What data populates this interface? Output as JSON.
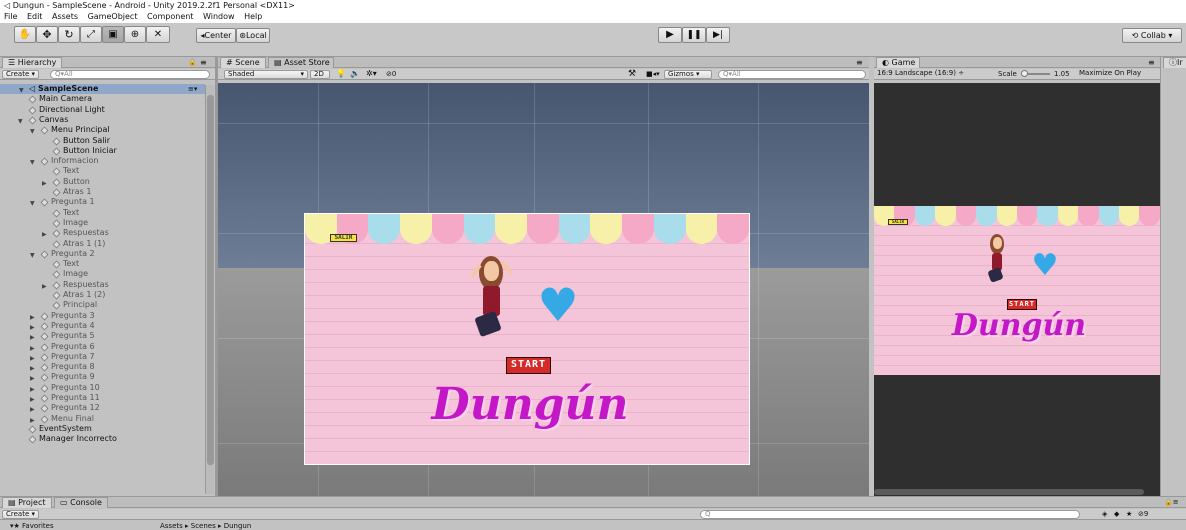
{
  "title": "Dungun - SampleScene - Android - Unity 2019.2.2f1 Personal <DX11>",
  "menu": [
    "File",
    "Edit",
    "Assets",
    "GameObject",
    "Component",
    "Window",
    "Help"
  ],
  "toolbar": {
    "tools": [
      "hand-tool",
      "move-tool",
      "rotate-tool",
      "scale-tool",
      "rect-tool",
      "transform-tool",
      "custom-tool"
    ],
    "center": "Center",
    "local": "Local",
    "collab": "Collab"
  },
  "hierarchy": {
    "tab": "Hierarchy",
    "create": "Create",
    "search": "All",
    "scene": "SampleScene",
    "items": [
      {
        "label": "Main Camera",
        "depth": 1,
        "expand": "",
        "dim": false,
        "bold": false
      },
      {
        "label": "Directional Light",
        "depth": 1,
        "expand": "",
        "dim": false,
        "bold": false
      },
      {
        "label": "Canvas",
        "depth": 1,
        "expand": "open",
        "dim": false,
        "bold": false
      },
      {
        "label": "Menu Principal",
        "depth": 2,
        "expand": "open",
        "dim": false,
        "bold": false
      },
      {
        "label": "Button Salir",
        "depth": 3,
        "expand": "",
        "dim": false,
        "bold": false
      },
      {
        "label": "Button Iniciar",
        "depth": 3,
        "expand": "",
        "dim": false,
        "bold": false
      },
      {
        "label": "Informacion",
        "depth": 2,
        "expand": "open",
        "dim": true,
        "bold": false
      },
      {
        "label": "Text",
        "depth": 3,
        "expand": "",
        "dim": true,
        "bold": false
      },
      {
        "label": "Button",
        "depth": 3,
        "expand": "closed",
        "dim": true,
        "bold": false
      },
      {
        "label": "Atras 1",
        "depth": 3,
        "expand": "",
        "dim": true,
        "bold": false
      },
      {
        "label": "Pregunta 1",
        "depth": 2,
        "expand": "open",
        "dim": true,
        "bold": false
      },
      {
        "label": "Text",
        "depth": 3,
        "expand": "",
        "dim": true,
        "bold": false
      },
      {
        "label": "Image",
        "depth": 3,
        "expand": "",
        "dim": true,
        "bold": false
      },
      {
        "label": "Respuestas",
        "depth": 3,
        "expand": "closed",
        "dim": true,
        "bold": false
      },
      {
        "label": "Atras 1 (1)",
        "depth": 3,
        "expand": "",
        "dim": true,
        "bold": false
      },
      {
        "label": "Pregunta 2",
        "depth": 2,
        "expand": "open",
        "dim": true,
        "bold": false
      },
      {
        "label": "Text",
        "depth": 3,
        "expand": "",
        "dim": true,
        "bold": false
      },
      {
        "label": "Image",
        "depth": 3,
        "expand": "",
        "dim": true,
        "bold": false
      },
      {
        "label": "Respuestas",
        "depth": 3,
        "expand": "closed",
        "dim": true,
        "bold": false
      },
      {
        "label": "Atras 1 (2)",
        "depth": 3,
        "expand": "",
        "dim": true,
        "bold": false
      },
      {
        "label": "Principal",
        "depth": 3,
        "expand": "",
        "dim": true,
        "bold": false
      },
      {
        "label": "Pregunta 3",
        "depth": 2,
        "expand": "closed",
        "dim": true,
        "bold": false
      },
      {
        "label": "Pregunta 4",
        "depth": 2,
        "expand": "closed",
        "dim": true,
        "bold": false
      },
      {
        "label": "Pregunta 5",
        "depth": 2,
        "expand": "closed",
        "dim": true,
        "bold": false
      },
      {
        "label": "Pregunta 6",
        "depth": 2,
        "expand": "closed",
        "dim": true,
        "bold": false
      },
      {
        "label": "Pregunta 7",
        "depth": 2,
        "expand": "closed",
        "dim": true,
        "bold": false
      },
      {
        "label": "Pregunta 8",
        "depth": 2,
        "expand": "closed",
        "dim": true,
        "bold": false
      },
      {
        "label": "Pregunta 9",
        "depth": 2,
        "expand": "closed",
        "dim": true,
        "bold": false
      },
      {
        "label": "Pregunta 10",
        "depth": 2,
        "expand": "closed",
        "dim": true,
        "bold": false
      },
      {
        "label": "Pregunta 11",
        "depth": 2,
        "expand": "closed",
        "dim": true,
        "bold": false
      },
      {
        "label": "Pregunta 12",
        "depth": 2,
        "expand": "closed",
        "dim": true,
        "bold": false
      },
      {
        "label": "Menu Final",
        "depth": 2,
        "expand": "closed",
        "dim": true,
        "bold": false
      },
      {
        "label": "EventSystem",
        "depth": 1,
        "expand": "",
        "dim": false,
        "bold": false
      },
      {
        "label": "Manager Incorrecto",
        "depth": 1,
        "expand": "",
        "dim": false,
        "bold": false
      }
    ]
  },
  "scene": {
    "tab": "Scene",
    "asset_tab": "Asset Store",
    "shading": "Shaded",
    "mode2d": "2D",
    "effects_count": "0",
    "gizmos": "Gizmos",
    "search": "All",
    "salir": "SALIR",
    "start": "START",
    "logo": "Dungún"
  },
  "game": {
    "tab": "Game",
    "aspect": "16:9 Landscape (16:9)",
    "scale_label": "Scale",
    "scale_value": "1.05",
    "maximize": "Maximize On Play",
    "extra": "M"
  },
  "inspector_tab": "Ir",
  "bottom": {
    "project": "Project",
    "console": "Console",
    "create": "Create",
    "favorites": "Favorites",
    "path": "Assets ▸ Scenes ▸ Dungun",
    "hidden_count": "9"
  },
  "colors": {
    "awning": [
      "#f6f0a8",
      "#f5a9c7",
      "#a9ddec",
      "#f6f0a8",
      "#f5a9c7",
      "#a9ddec",
      "#f6f0a8",
      "#f5a9c7",
      "#a9ddec",
      "#f6f0a8",
      "#f5a9c7",
      "#a9ddec",
      "#f6f0a8",
      "#f5a9c7"
    ]
  }
}
